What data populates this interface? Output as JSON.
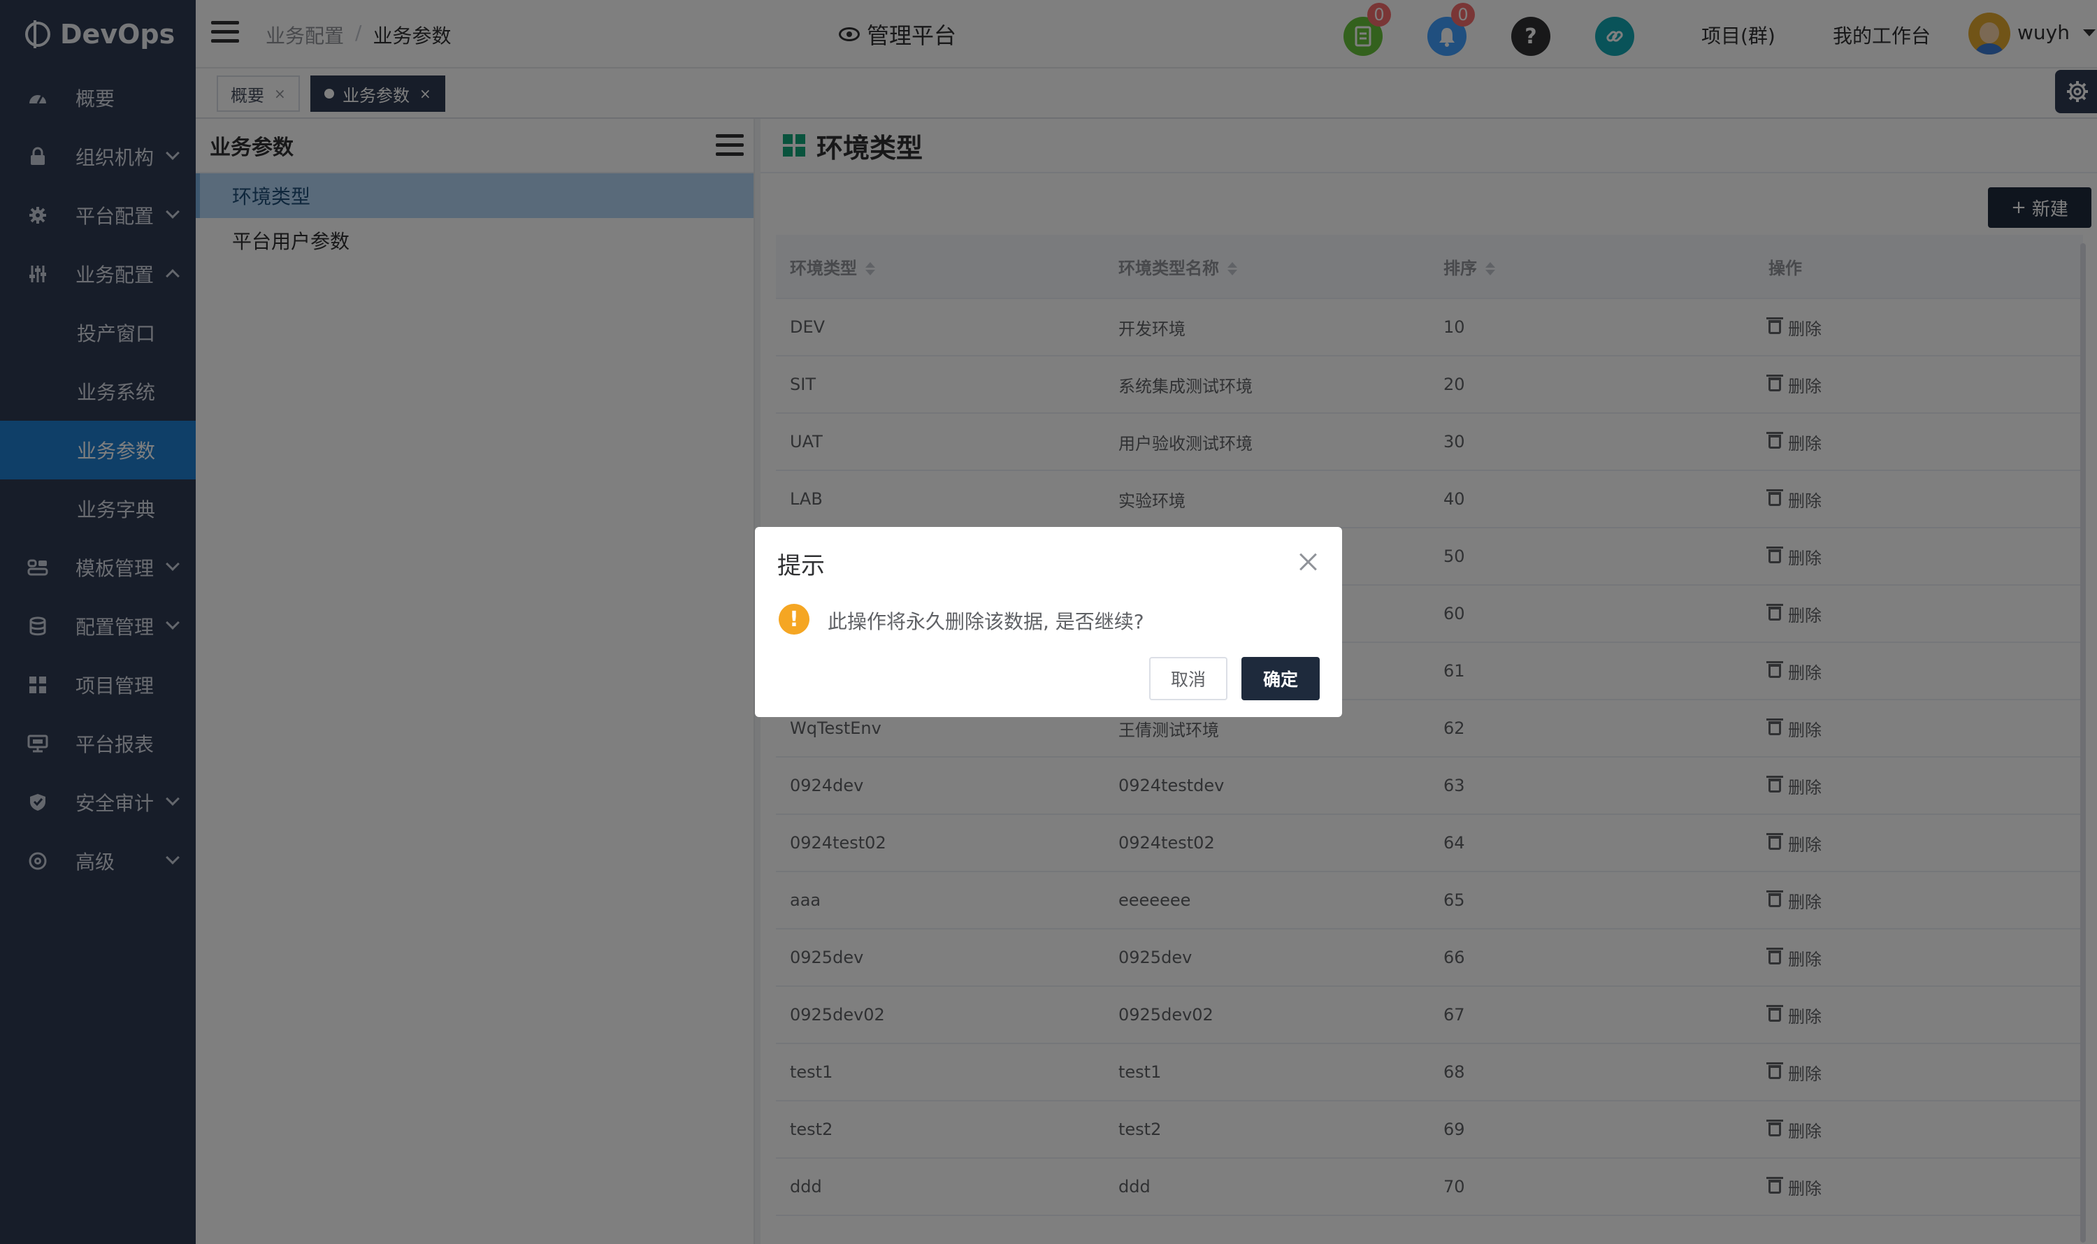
{
  "app": {
    "logo_text": "DevOps"
  },
  "sidebar": {
    "items": [
      {
        "label": "概要",
        "icon": "dashboard-icon",
        "expandable": false
      },
      {
        "label": "组织机构",
        "icon": "lock-icon",
        "expandable": true
      },
      {
        "label": "平台配置",
        "icon": "gear-icon",
        "expandable": true
      },
      {
        "label": "业务配置",
        "icon": "sliders-icon",
        "expandable": true,
        "expanded": true,
        "children": [
          {
            "label": "投产窗口",
            "active": false
          },
          {
            "label": "业务系统",
            "active": false
          },
          {
            "label": "业务参数",
            "active": true
          },
          {
            "label": "业务字典",
            "active": false
          }
        ]
      },
      {
        "label": "模板管理",
        "icon": "template-icon",
        "expandable": true
      },
      {
        "label": "配置管理",
        "icon": "database-icon",
        "expandable": true
      },
      {
        "label": "项目管理",
        "icon": "grid-icon",
        "expandable": false
      },
      {
        "label": "平台报表",
        "icon": "monitor-icon",
        "expandable": false
      },
      {
        "label": "安全审计",
        "icon": "shield-icon",
        "expandable": true
      },
      {
        "label": "高级",
        "icon": "advanced-icon",
        "expandable": true
      }
    ]
  },
  "header": {
    "breadcrumb": [
      "业务配置",
      "业务参数"
    ],
    "breadcrumb_sep": "/",
    "platform": "管理平台",
    "tasks_badge": "0",
    "notifications_badge": "0",
    "help_glyph": "?",
    "projects_link": "项目(群)",
    "workbench_link": "我的工作台",
    "username": "wuyh"
  },
  "tabs": [
    {
      "label": "概要",
      "active": false
    },
    {
      "label": "业务参数",
      "active": true
    }
  ],
  "param_panel": {
    "title": "业务参数",
    "items": [
      {
        "label": "环境类型",
        "active": true
      },
      {
        "label": "平台用户参数",
        "active": false
      }
    ]
  },
  "main": {
    "title": "环境类型",
    "new_button": "新建",
    "columns": [
      "环境类型",
      "环境类型名称",
      "排序",
      "操作"
    ],
    "delete_label": "删除",
    "rows": [
      {
        "type": "DEV",
        "name": "开发环境",
        "order": "10"
      },
      {
        "type": "SIT",
        "name": "系统集成测试环境",
        "order": "20"
      },
      {
        "type": "UAT",
        "name": "用户验收测试环境",
        "order": "30"
      },
      {
        "type": "LAB",
        "name": "实验环境",
        "order": "40"
      },
      {
        "type": "",
        "name": "",
        "order": "50"
      },
      {
        "type": "",
        "name": "",
        "order": "60"
      },
      {
        "type": "",
        "name": "",
        "order": "61"
      },
      {
        "type": "WqTestEnv",
        "name": "王倩测试环境",
        "order": "62"
      },
      {
        "type": "0924dev",
        "name": "0924testdev",
        "order": "63"
      },
      {
        "type": "0924test02",
        "name": "0924test02",
        "order": "64"
      },
      {
        "type": "aaa",
        "name": "eeeeeee",
        "order": "65"
      },
      {
        "type": "0925dev",
        "name": "0925dev",
        "order": "66"
      },
      {
        "type": "0925dev02",
        "name": "0925dev02",
        "order": "67"
      },
      {
        "type": "test1",
        "name": "test1",
        "order": "68"
      },
      {
        "type": "test2",
        "name": "test2",
        "order": "69"
      },
      {
        "type": "ddd",
        "name": "ddd",
        "order": "70"
      }
    ]
  },
  "dialog": {
    "title": "提示",
    "message": "此操作将永久删除该数据, 是否继续?",
    "cancel": "取消",
    "confirm": "确定"
  },
  "colors": {
    "sidebar_bg": "#2f3b52",
    "active_menu": "#1f7ed0",
    "primary_dark": "#1e2a3c",
    "warning": "#f5a623",
    "badge": "#f56c6c",
    "tasks_icon": "#67c23a",
    "notify_icon": "#409eff",
    "help_icon": "#303133",
    "link_icon": "#13a7b3"
  }
}
